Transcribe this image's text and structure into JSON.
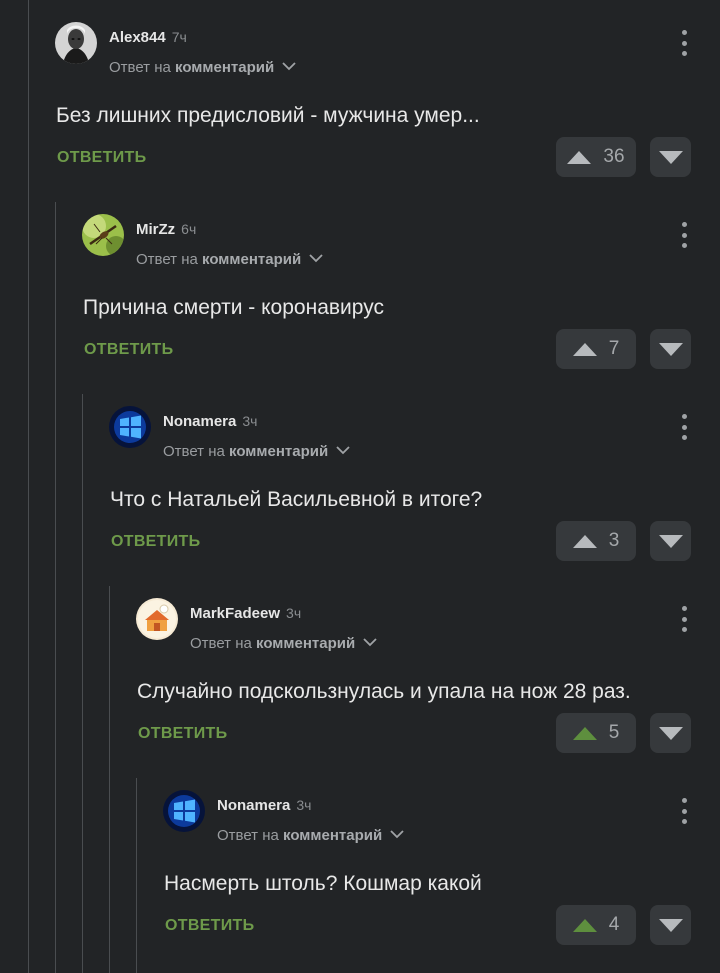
{
  "labels": {
    "reply_prefix": "Ответ на",
    "reply_target": "комментарий",
    "reply_button": "ОТВЕТИТЬ"
  },
  "colors": {
    "background": "#222426",
    "reply_green": "#6e9a4a",
    "upvoted_arrow": "#5e8f3e",
    "neutral_arrow": "#b7babd"
  },
  "comments": [
    {
      "user": "Alex844",
      "time": "7ч",
      "text": "Без лишних предисловий - мужчина умер...",
      "rating": "36",
      "upvoted": false,
      "avatar": "avatar-portrait-icon"
    },
    {
      "user": "MirZz",
      "time": "6ч",
      "text": "Причина смерти - коронавирус",
      "rating": "7",
      "upvoted": false,
      "avatar": "avatar-insect-icon"
    },
    {
      "user": "Nonamera",
      "time": "3ч",
      "text": "Что с Натальей Васильевной в итоге?",
      "rating": "3",
      "upvoted": false,
      "avatar": "avatar-windows-logo-icon"
    },
    {
      "user": "MarkFadeew",
      "time": "3ч",
      "text": "Случайно подскользнулась и упала на нож 28 раз.",
      "rating": "5",
      "upvoted": true,
      "avatar": "avatar-cartoon-icon"
    },
    {
      "user": "Nonamera",
      "time": "3ч",
      "text": "Насмерть штоль? Кошмар какой",
      "rating": "4",
      "upvoted": true,
      "avatar": "avatar-windows-logo-icon"
    }
  ]
}
